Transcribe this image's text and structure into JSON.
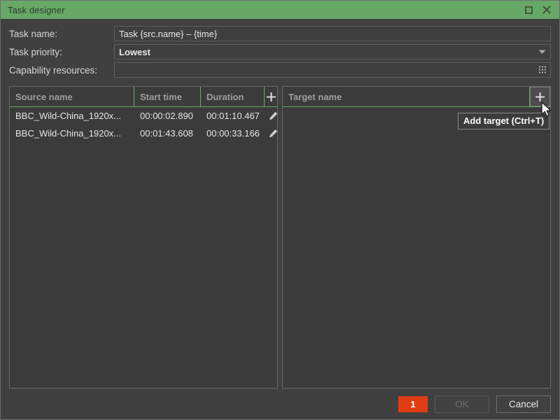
{
  "window": {
    "title": "Task designer",
    "maximize_icon": "maximize-icon",
    "close_icon": "close-icon"
  },
  "form": {
    "task_name": {
      "label": "Task name:",
      "value": "Task {src.name} – {time}",
      "placeholder": ""
    },
    "task_priority": {
      "label": "Task priority:",
      "value": "Lowest",
      "options": [
        "Lowest"
      ],
      "arrow_icon": "chevron-down-icon"
    },
    "capability_resources": {
      "label": "Capability resources:",
      "value": "",
      "placeholder": "",
      "grip_icon": "grid-dots-icon"
    }
  },
  "source_panel": {
    "columns": [
      "Source name",
      "Start time",
      "Duration"
    ],
    "add_label": "+",
    "add_icon": "plus-icon",
    "rows": [
      {
        "source_name": "BBC_Wild-China_1920x...",
        "start_time": "00:00:02.890",
        "duration": "00:01:10.467",
        "edit_icon": "pencil-icon",
        "delete_icon": "trash-icon"
      },
      {
        "source_name": "BBC_Wild-China_1920x...",
        "start_time": "00:01:43.608",
        "duration": "00:00:33.166",
        "edit_icon": "pencil-icon",
        "delete_icon": "trash-icon"
      }
    ]
  },
  "target_panel": {
    "column": "Target name",
    "add_label": "+",
    "add_icon": "plus-icon",
    "rows": []
  },
  "tooltip": {
    "text": "Add target (Ctrl+T)"
  },
  "footer": {
    "badge": "1",
    "ok_label": "OK",
    "cancel_label": "Cancel"
  },
  "colors": {
    "titlebar_green": "#66a868",
    "accent_green": "#6aa76a",
    "badge_red": "#e03c14",
    "window_bg": "#404040",
    "panel_bg": "#3b3b3b"
  }
}
